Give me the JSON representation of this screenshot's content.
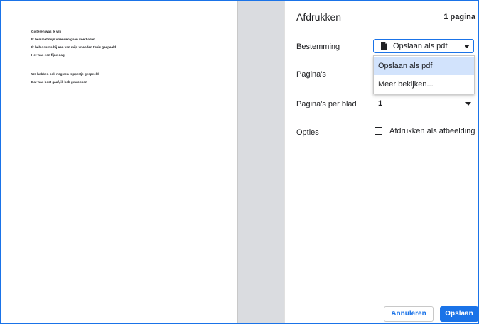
{
  "preview": {
    "lines": [
      "Gisteren was ik vrij",
      "Ik ben met mijn vrienden gaan voetballen",
      "Ik heb daarna bij een van mijn vrienden thuis gespeeld",
      "Het was een fijne dag",
      "We hebben ook nog een toppertje gespeeld",
      "Dat was best gaaf, ik heb gewonnen"
    ]
  },
  "settings": {
    "title": "Afdrukken",
    "page_count": "1 pagina",
    "destination": {
      "label": "Bestemming",
      "value": "Opslaan als pdf",
      "icon": "file-icon",
      "menu_items": [
        "Opslaan als pdf",
        "Meer bekijken..."
      ]
    },
    "pages": {
      "label": "Pagina's"
    },
    "pages_per_sheet": {
      "label": "Pagina's per blad",
      "value": "1"
    },
    "options": {
      "label": "Opties",
      "checkbox_label": "Afdrukken als afbeelding",
      "checked": false
    }
  },
  "buttons": {
    "cancel": "Annuleren",
    "save": "Opslaan"
  },
  "colors": {
    "accent": "#1a73e8",
    "menu_highlight": "#d2e3fc",
    "preview_background": "#dadce0"
  }
}
